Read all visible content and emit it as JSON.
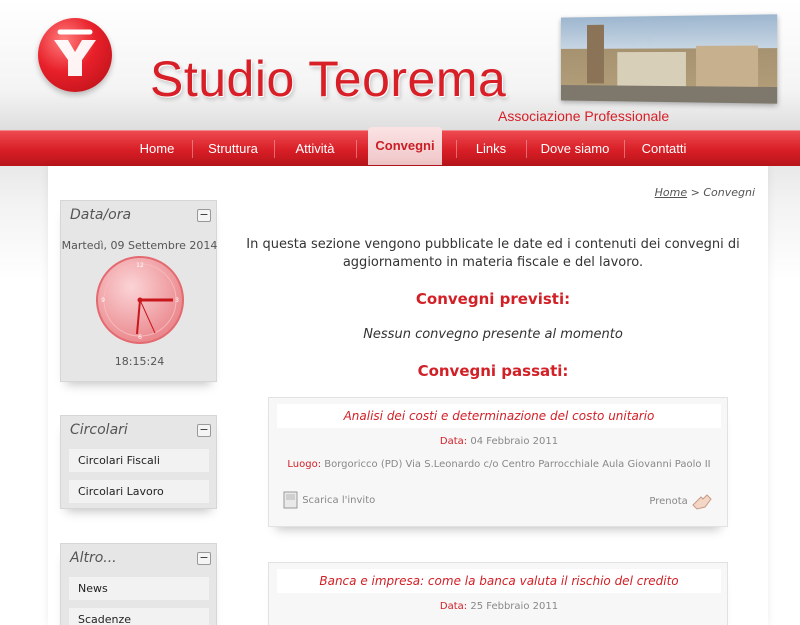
{
  "header": {
    "brand": "Studio Teorema",
    "subtitle": "Associazione Professionale"
  },
  "nav": {
    "items": [
      {
        "label": "Home"
      },
      {
        "label": "Struttura"
      },
      {
        "label": "Attività"
      },
      {
        "label": "Convegni",
        "active": true
      },
      {
        "label": "Links"
      },
      {
        "label": "Dove siamo"
      },
      {
        "label": "Contatti"
      }
    ]
  },
  "breadcrumb": {
    "home": "Home",
    "separator": ">",
    "current": "Convegni"
  },
  "sidebar": {
    "datetime": {
      "title": "Data/ora",
      "date": "Martedì, 09 Settembre 2014",
      "time": "18:15:24",
      "minimize": "−"
    },
    "circolari": {
      "title": "Circolari",
      "minimize": "−",
      "items": [
        {
          "label": "Circolari Fiscali"
        },
        {
          "label": "Circolari Lavoro"
        }
      ]
    },
    "altro": {
      "title": "Altro...",
      "minimize": "−",
      "items": [
        {
          "label": "News"
        },
        {
          "label": "Scadenze"
        }
      ]
    }
  },
  "content": {
    "intro": "In questa sezione vengono pubblicate le date ed i contenuti dei convegni di aggiornamento in materia fiscale e del lavoro.",
    "upcoming_title": "Convegni previsti:",
    "upcoming_none": "Nessun convegno presente al momento",
    "past_title": "Convegni passati:",
    "events": [
      {
        "title": "Analisi dei costi e determinazione del costo unitario",
        "date_label": "Data:",
        "date": "04 Febbraio 2011",
        "place_label": "Luogo:",
        "place": "Borgoricco (PD) Via S.Leonardo c/o Centro Parrocchiale Aula Giovanni Paolo II",
        "download": "Scarica l'invito",
        "book": "Prenota"
      },
      {
        "title": "Banca e impresa: come la banca valuta il rischio del credito",
        "date_label": "Data:",
        "date": "25 Febbraio 2011"
      }
    ]
  },
  "colors": {
    "brand_red": "#d81e26",
    "nav_active_bg": "#f0c6c8"
  }
}
